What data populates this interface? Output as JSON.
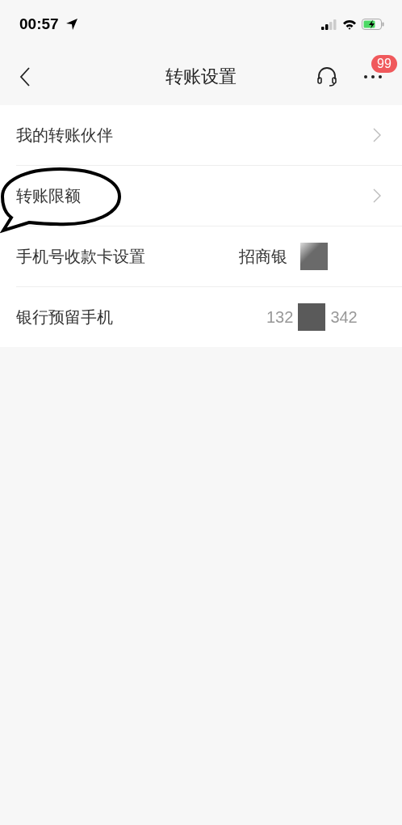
{
  "status_bar": {
    "time": "00:57"
  },
  "nav": {
    "title": "转账设置",
    "badge": "99"
  },
  "rows": [
    {
      "kind": "link",
      "label": "我的转账伙伴",
      "circled": false
    },
    {
      "kind": "link",
      "label": "转账限额",
      "circled": true
    },
    {
      "kind": "value",
      "label": "手机号收款卡设置",
      "value": "招商银"
    },
    {
      "kind": "masked",
      "label": "银行预留手机",
      "value_start": "132",
      "value_end": "342"
    }
  ]
}
